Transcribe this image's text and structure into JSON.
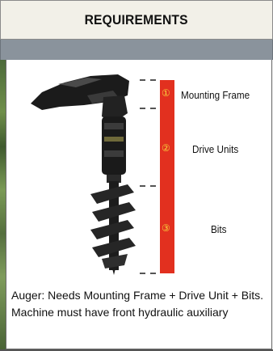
{
  "header": {
    "title": "REQUIREMENTS"
  },
  "diagram": {
    "sections": [
      {
        "number": "①",
        "label": "Mounting Frame"
      },
      {
        "number": "②",
        "label": "Drive Units"
      },
      {
        "number": "③",
        "label": "Bits"
      }
    ],
    "colors": {
      "bar": "#e2301f",
      "numerals": "#f7d23c",
      "dash": "#555555"
    }
  },
  "caption": "Auger: Needs Mounting Frame + Drive Unit + Bits. Machine must have front hydraulic auxiliary"
}
